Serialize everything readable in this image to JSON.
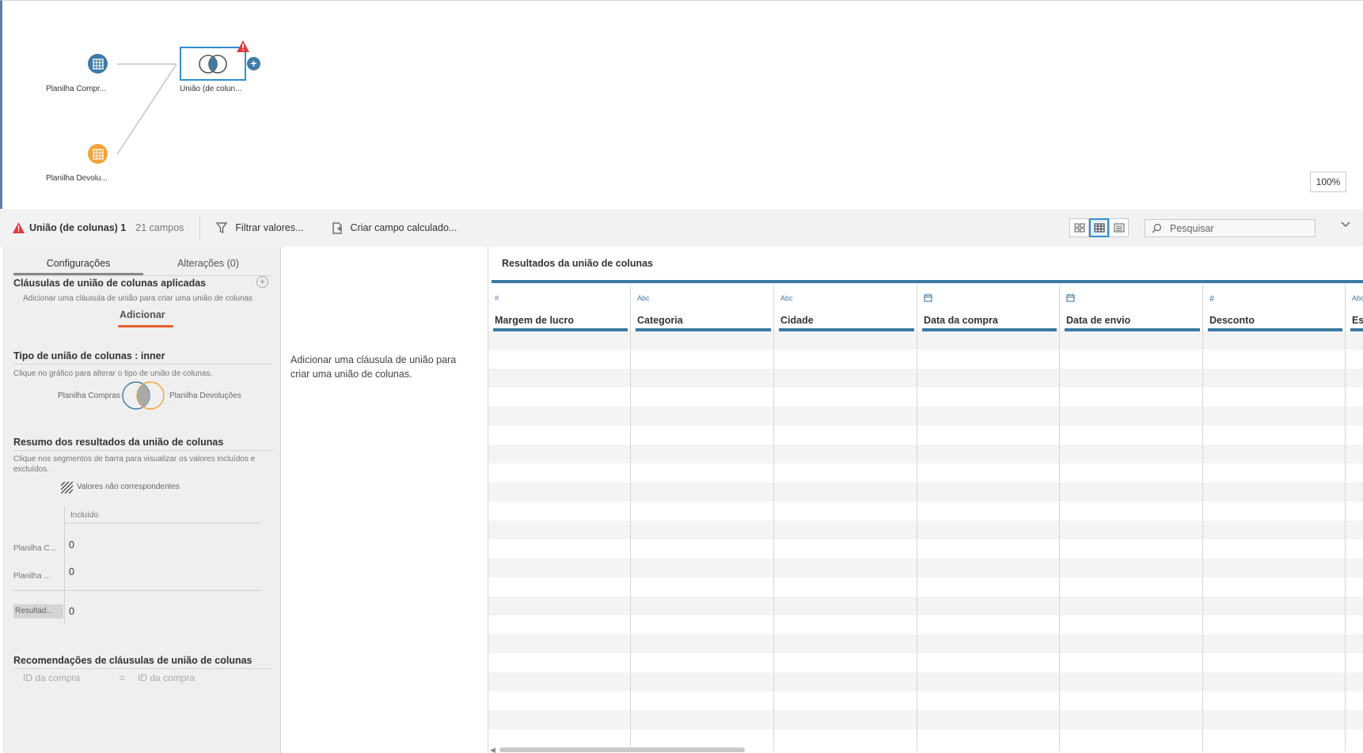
{
  "flow": {
    "node_compras_label": "Planilha Compr...",
    "node_devolucoes_label": "Planilha Devolu...",
    "join_node_label": "União (de colun...",
    "zoom_level": "100%",
    "colors": {
      "blue": "#3e7ca6",
      "orange": "#f0a33a",
      "join_border": "#2f8fd1",
      "warning": "#e03a3e"
    }
  },
  "toolbar": {
    "step_title": "União (de colunas) 1",
    "field_count": "21 campos",
    "filter_label": "Filtrar valores...",
    "calc_field_label": "Criar campo calculado...",
    "search_placeholder": "Pesquisar"
  },
  "settings": {
    "tabs": [
      {
        "label": "Configurações",
        "active": true
      },
      {
        "label": "Alterações (0)",
        "active": false
      }
    ],
    "clauses_title": "Cláusulas de união de colunas aplicadas",
    "clauses_hint": "Adicionar uma cláusula de união para criar uma união de colunas",
    "add_label": "Adicionar",
    "join_type_title": "Tipo de união de colunas : inner",
    "join_type_hint": "Clique no gráfico para alterar o tipo de união de colunas.",
    "venn_left_label": "Planilha Compras",
    "venn_right_label": "Planilha Devoluções",
    "summary_title": "Resumo dos resultados da união de colunas",
    "summary_hint": "Clique nos segmentos de barra para visualizar os valores incluídos e excluídos.",
    "unmatched_label": "Valores não correspondentes",
    "included_header": "Incluído",
    "summary_rows": [
      {
        "label": "Planilha C...",
        "value": "0"
      },
      {
        "label": "Planilha ...",
        "value": "0"
      }
    ],
    "result_label": "Resultad...",
    "result_value": "0",
    "recommendations_title": "Recomendações de cláusulas de união de colunas",
    "recommendation": {
      "left": "ID da compra",
      "op": "=",
      "right": "ID da compra"
    }
  },
  "middle_message": "Adicionar uma cláusula de união para criar uma união de colunas.",
  "results": {
    "title": "Resultados da união de colunas",
    "columns": [
      {
        "type": "#",
        "name": "Margem de lucro"
      },
      {
        "type": "Abc",
        "name": "Categoria"
      },
      {
        "type": "Abc",
        "name": "Cidade"
      },
      {
        "type": "calendar-icon",
        "name": "Data da compra"
      },
      {
        "type": "calendar-icon",
        "name": "Data de envio"
      },
      {
        "type": "#",
        "name": "Desconto"
      },
      {
        "type": "Abc",
        "name": "Est"
      }
    ]
  }
}
